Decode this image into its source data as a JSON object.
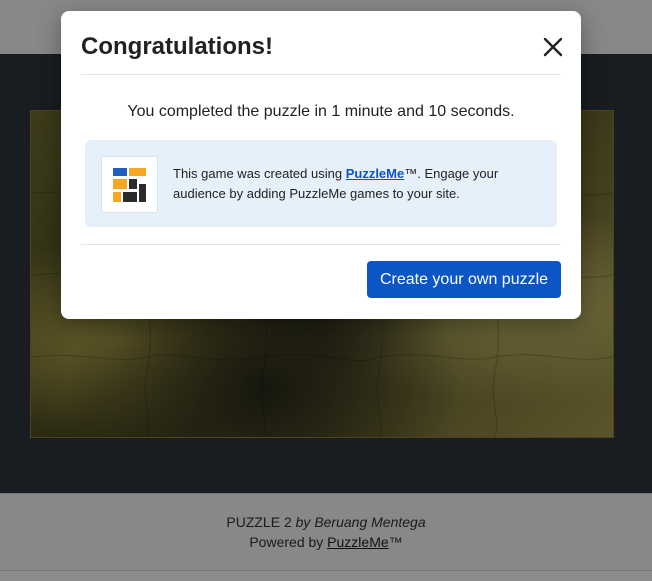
{
  "modal": {
    "title": "Congratulations!",
    "message": "You completed the puzzle in 1 minute and 10 seconds.",
    "promo": {
      "text_before": "This game was created using ",
      "link_label": "PuzzleMe",
      "text_after": "™. Engage your audience by adding PuzzleMe games to your site."
    },
    "cta_label": "Create your own puzzle",
    "close_icon": "close-icon"
  },
  "footer": {
    "puzzle_name": "PUZZLE 2",
    "by": "by",
    "author": "Beruang Mentega",
    "powered_by": "Powered by",
    "brand": "PuzzleMe",
    "tm": "™"
  },
  "colors": {
    "accent": "#0b55c4",
    "promo_bg": "#e6f0fb",
    "logo_orange": "#f5a623",
    "logo_dark": "#2b2b2b",
    "logo_blue": "#1f5fbf"
  }
}
